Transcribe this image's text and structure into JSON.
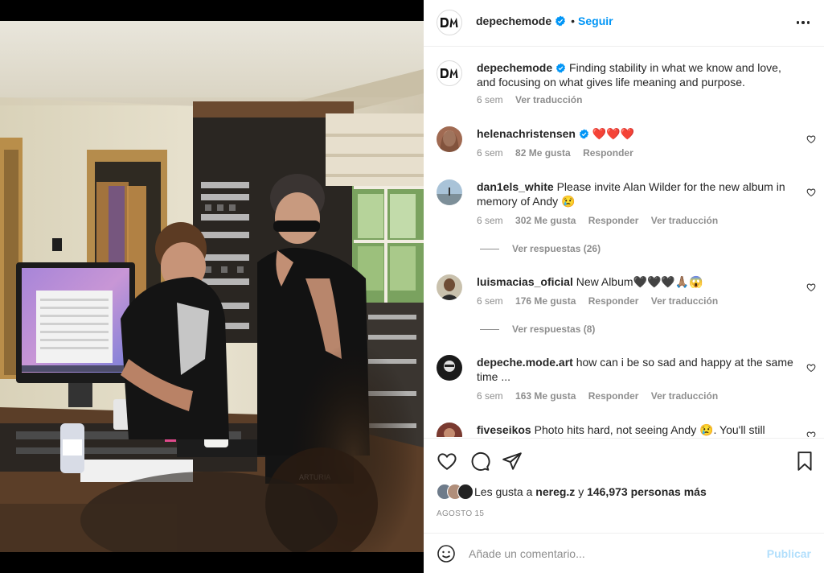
{
  "post": {
    "author": "depechemode",
    "follow_label": "Seguir",
    "dot": "•"
  },
  "comments": [
    {
      "user": "depechemode",
      "text": "Finding stability in what we know and love, and focusing on what gives life meaning and purpose.",
      "time": "6 sem",
      "likes": "",
      "reply": "",
      "translate": "Ver traducción"
    },
    {
      "user": "helenachristensen",
      "text": "❤️❤️❤️",
      "time": "6 sem",
      "likes": "82 Me gusta",
      "reply": "Responder",
      "translate": ""
    },
    {
      "user": "dan1els_white",
      "text": "Please invite Alan Wilder for the new album in memory of Andy 😢",
      "time": "6 sem",
      "likes": "302 Me gusta",
      "reply": "Responder",
      "translate": "Ver traducción",
      "replies": "Ver respuestas (26)"
    },
    {
      "user": "luismacias_oficial",
      "text": "New Album🖤🖤🖤🙏🏽😱",
      "time": "6 sem",
      "likes": "176 Me gusta",
      "reply": "Responder",
      "translate": "Ver traducción",
      "replies": "Ver respuestas (8)"
    },
    {
      "user": "depeche.mode.art",
      "text": "how can i be so sad and happy at the same time ...",
      "time": "6 sem",
      "likes": "163 Me gusta",
      "reply": "Responder",
      "translate": "Ver traducción"
    },
    {
      "user": "fiveseikos",
      "text": "Photo hits hard, not seeing Andy 😢. You'll still",
      "time": "",
      "likes": "",
      "reply": "",
      "translate": ""
    }
  ],
  "likes_summary": {
    "prefix": "Les gusta a",
    "user": "nereg.z",
    "conj": "y",
    "rest": "146,973 personas más"
  },
  "date": "AGOSTO 15",
  "comment_box": {
    "placeholder": "Añade un comentario...",
    "publish_label": "Publicar"
  },
  "colors": {
    "accent": "#0095f6",
    "muted": "#8e8e8e",
    "publish_disabled": "#b2dffc"
  },
  "icons": [
    "heart-icon",
    "comment-icon",
    "share-icon",
    "bookmark-icon",
    "more-icon",
    "emoji-icon",
    "verified-icon"
  ]
}
